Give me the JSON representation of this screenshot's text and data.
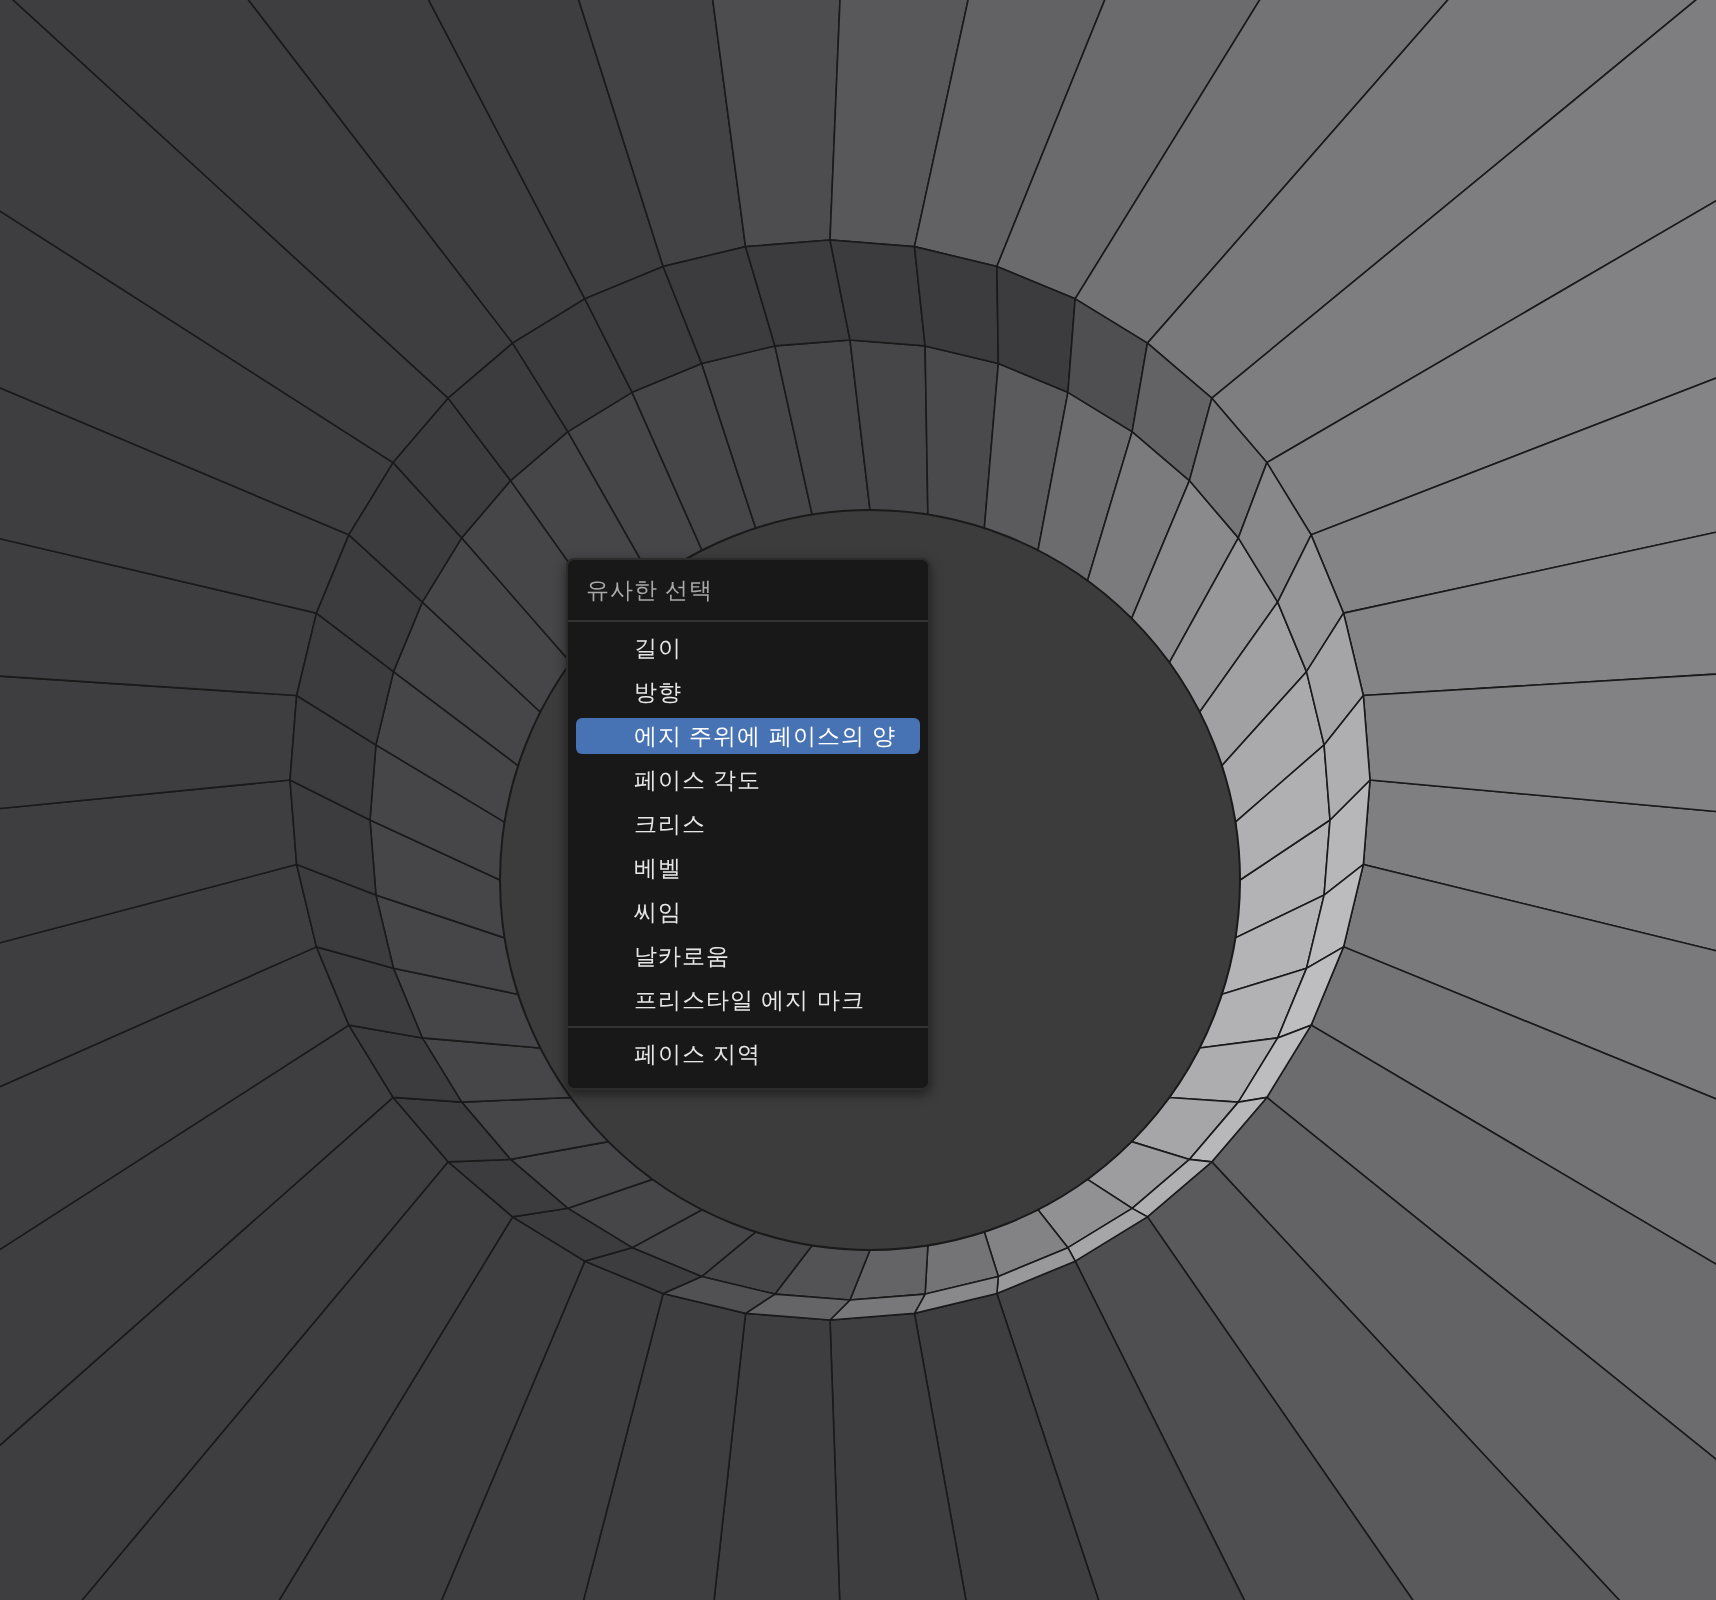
{
  "menu": {
    "title": "유사한 선택",
    "sections": [
      {
        "items": [
          {
            "label": "길이",
            "selected": false
          },
          {
            "label": "방향",
            "selected": false
          },
          {
            "label": "에지 주위에 페이스의 양",
            "selected": true
          },
          {
            "label": "페이스 각도",
            "selected": false
          },
          {
            "label": "크리스",
            "selected": false
          },
          {
            "label": "베벨",
            "selected": false
          },
          {
            "label": "씨임",
            "selected": false
          },
          {
            "label": "날카로움",
            "selected": false
          },
          {
            "label": "프리스타일 에지 마크",
            "selected": false
          }
        ]
      },
      {
        "items": [
          {
            "label": "페이스 지역",
            "selected": false
          }
        ]
      }
    ]
  }
}
